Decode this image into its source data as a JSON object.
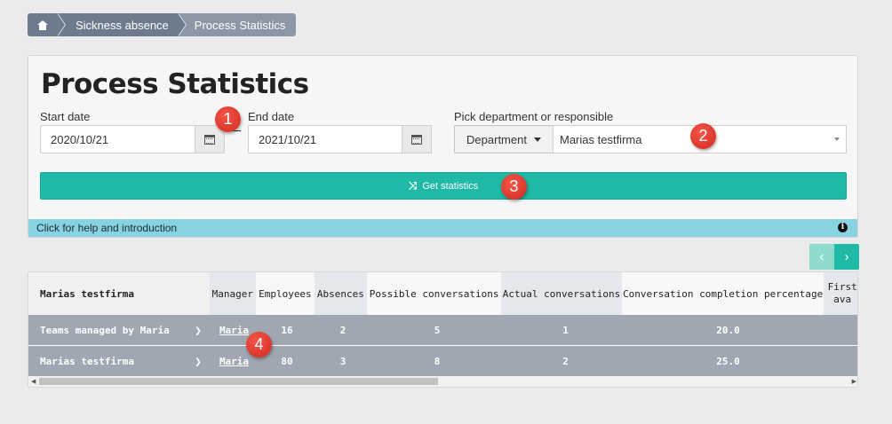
{
  "breadcrumb": {
    "home_icon": "home-icon",
    "items": [
      "Sickness absence",
      "Process Statistics"
    ]
  },
  "page": {
    "title": "Process Statistics",
    "start_label": "Start date",
    "start_value": "2020/10/21",
    "end_label": "End date",
    "end_value": "2021/10/21",
    "pick_label": "Pick department or responsible",
    "dept_button": "Department",
    "selected_org": "Marias testfirma",
    "get_button": "Get statistics",
    "help_text": "Click for help and introduction",
    "info_icon": "i"
  },
  "badges": [
    "1",
    "2",
    "3",
    "4"
  ],
  "pager": {
    "prev": "‹",
    "next": "›"
  },
  "table": {
    "headers": [
      "Marias testfirma",
      "Manager",
      "Employees",
      "Absences",
      "Possible conversations",
      "Actual conversations",
      "Conversation completion percentage",
      "First ava"
    ],
    "rows": [
      {
        "name": "Teams managed by Maria",
        "manager": "Maria",
        "employees": "16",
        "absences": "2",
        "possible": "5",
        "actual": "1",
        "pct": "20.0"
      },
      {
        "name": "Marias testfirma",
        "manager": "Maria",
        "employees": "80",
        "absences": "3",
        "possible": "8",
        "actual": "2",
        "pct": "25.0"
      }
    ]
  },
  "colors": {
    "accent": "#1fbaa5",
    "help_bar": "#88d3e2",
    "row_bg": "#a0a6b2",
    "badge": "#e0392c"
  }
}
